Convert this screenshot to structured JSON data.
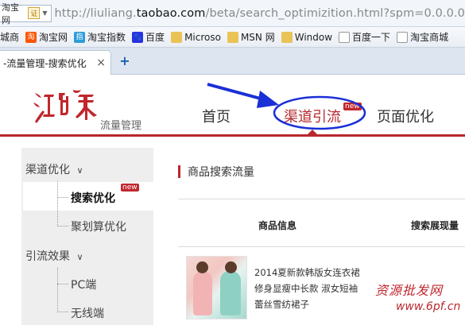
{
  "browser": {
    "site_chip": "淘宝网",
    "site_chip_cert": "证",
    "url_prefix": "http://liuliang.",
    "url_domain": "taobao.com",
    "url_rest": "/beta/search_optimizition.html?spm=0.0.0.0"
  },
  "bookmarks": [
    {
      "label": "城商",
      "icon": "folder-icon"
    },
    {
      "label": "淘宝网",
      "icon": "taobao-icon"
    },
    {
      "label": "淘宝指数",
      "icon": "zhishu-icon"
    },
    {
      "label": "百度",
      "icon": "baidu-icon"
    },
    {
      "label": "Microso",
      "icon": "folder-icon"
    },
    {
      "label": "MSN 网",
      "icon": "folder-icon"
    },
    {
      "label": "Window",
      "icon": "folder-icon"
    },
    {
      "label": "百度一下",
      "icon": "page-icon"
    },
    {
      "label": "淘宝商城",
      "icon": "tmall-icon"
    }
  ],
  "tab": {
    "title": "-流量管理-搜索优化",
    "close": "×",
    "new": "+"
  },
  "header": {
    "logo_text": "江湖策",
    "logo_sub": "流量管理",
    "nav": {
      "home": "首页",
      "channel": "渠道引流",
      "channel_badge": "new",
      "page": "页面优化"
    }
  },
  "sidebar": {
    "group1": "渠道优化",
    "group1_chevron": "∨",
    "item_search": "搜索优化",
    "item_search_badge": "new",
    "item_juhuasuan": "聚划算优化",
    "group2": "引流效果",
    "group2_chevron": "∨",
    "item_pc": "PC端",
    "item_wireless": "无线端"
  },
  "main": {
    "section_title": "商品搜索流量",
    "col_info": "商品信息",
    "col_exposure": "搜索展现量",
    "product_lines": [
      "2014夏新款韩版女连衣裙",
      "修身显瘦中长款 淑女短袖",
      "蕾丝雪纺裙子"
    ]
  },
  "watermark": {
    "line1": "资源批发网",
    "line2": "www.6pf.cn"
  },
  "colors": {
    "brand_red": "#b8282e",
    "annotation_blue": "#1a2fd6"
  }
}
